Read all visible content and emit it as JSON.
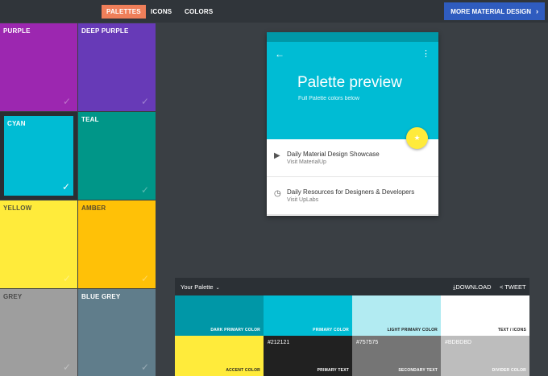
{
  "nav": {
    "tabs": [
      {
        "label": "PALETTES",
        "active": true
      },
      {
        "label": "ICONS",
        "active": false
      },
      {
        "label": "COLORS",
        "active": false
      }
    ],
    "more_button": "MORE MATERIAL DESIGN",
    "more_icon": "chevron-right-icon"
  },
  "swatches": [
    {
      "name": "PURPLE",
      "color": "#9c27b0"
    },
    {
      "name": "DEEP PURPLE",
      "color": "#673ab7"
    },
    {
      "name": "CYAN",
      "color": "#00bcd4",
      "selected": true
    },
    {
      "name": "TEAL",
      "color": "#009688"
    },
    {
      "name": "YELLOW",
      "color": "#ffeb3b"
    },
    {
      "name": "AMBER",
      "color": "#ffc107"
    },
    {
      "name": "GREY",
      "color": "#9e9e9e"
    },
    {
      "name": "BLUE GREY",
      "color": "#607d8b"
    }
  ],
  "preview": {
    "title": "Palette preview",
    "subtitle": "Full Palette colors below",
    "back_icon": "arrow-back-icon",
    "menu_icon": "more-vert-icon",
    "fab_icon": "star-icon",
    "items": [
      {
        "title": "Daily Material Design Showcase",
        "subtitle": "Visit MaterialUp",
        "icon": "label-icon"
      },
      {
        "title": "Daily Resources for Designers & Developers",
        "subtitle": "Visit UpLabs",
        "icon": "clock-icon"
      }
    ]
  },
  "palette": {
    "title": "Your Palette",
    "download": "DOWNLOAD",
    "tweet": "TWEET",
    "cells": [
      {
        "label": "DARK PRIMARY COLOR",
        "value": "",
        "bg": "#0097a7",
        "fg": "#ffffff"
      },
      {
        "label": "PRIMARY COLOR",
        "value": "",
        "bg": "#00bcd4",
        "fg": "#ffffff"
      },
      {
        "label": "LIGHT PRIMARY COLOR",
        "value": "",
        "bg": "#b2ebf2",
        "fg": "#212121"
      },
      {
        "label": "TEXT / ICONS",
        "value": "",
        "bg": "#ffffff",
        "fg": "#212121"
      },
      {
        "label": "ACCENT COLOR",
        "value": "",
        "bg": "#ffeb3b",
        "fg": "#212121"
      },
      {
        "label": "PRIMARY TEXT",
        "value": "#212121",
        "bg": "#212121",
        "fg": "#ffffff"
      },
      {
        "label": "SECONDARY TEXT",
        "value": "#757575",
        "bg": "#757575",
        "fg": "#ffffff"
      },
      {
        "label": "DIVIDER COLOR",
        "value": "#BDBDBD",
        "bg": "#bdbdbd",
        "fg": "#ffffff"
      }
    ]
  }
}
